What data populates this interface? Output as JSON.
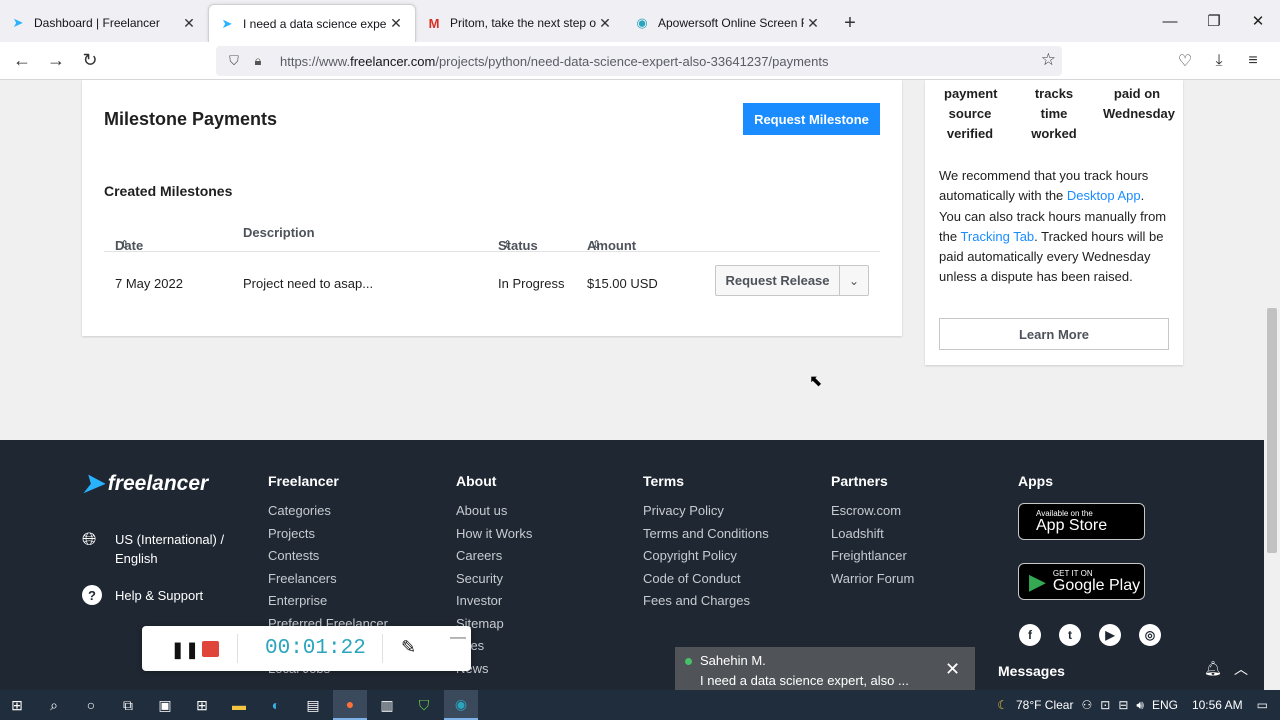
{
  "browser": {
    "tabs": [
      {
        "title": "Dashboard | Freelancer",
        "icon": "freelancer-icon",
        "active": false
      },
      {
        "title": "I need a data science expert, also",
        "icon": "freelancer-icon",
        "active": true
      },
      {
        "title": "Pritom, take the next step on yo",
        "icon": "gmail-icon",
        "active": false
      },
      {
        "title": "Apowersoft Online Screen Reco",
        "icon": "apowersoft-icon",
        "active": false
      }
    ],
    "url_prefix": "https://www.",
    "url_domain": "freelancer.com",
    "url_path": "/projects/python/need-data-science-expert-also-33641237/payments"
  },
  "milestones": {
    "title": "Milestone Payments",
    "request_button": "Request Milestone",
    "created_title": "Created Milestones",
    "columns": {
      "date": "Date",
      "description": "Description",
      "status": "Status",
      "amount": "Amount"
    },
    "rows": [
      {
        "date": "7 May 2022",
        "description": "Project need to asap...",
        "status": "In Progress",
        "amount": "$15.00 USD",
        "action": "Request Release"
      }
    ]
  },
  "sidebar": {
    "col1": [
      "payment",
      "source",
      "verified"
    ],
    "col2": [
      "tracks time",
      "worked"
    ],
    "col3": [
      "paid on",
      "Wednesday"
    ],
    "text_before_app": "We recommend that you track hours automatically with the ",
    "link_app": "Desktop App",
    "text_mid": ". You can also track hours manually from the ",
    "link_tab": "Tracking Tab",
    "text_after": ". Tracked hours will be paid automatically every Wednesday unless a dispute has been raised.",
    "learn_more": "Learn More"
  },
  "footer": {
    "logo": "freelancer",
    "language": "US (International) / English",
    "help": "Help & Support",
    "columns": [
      {
        "title": "Freelancer",
        "links": [
          "Categories",
          "Projects",
          "Contests",
          "Freelancers",
          "Enterprise",
          "Preferred Freelancer",
          "",
          "Local Jobs"
        ]
      },
      {
        "title": "About",
        "links": [
          "About us",
          "How it Works",
          "Careers",
          "Security",
          "Investor",
          "Sitemap",
          "ories",
          "News"
        ]
      },
      {
        "title": "Terms",
        "links": [
          "Privacy Policy",
          "Terms and Conditions",
          "Copyright Policy",
          "Code of Conduct",
          "Fees and Charges"
        ]
      },
      {
        "title": "Partners",
        "links": [
          "Escrow.com",
          "Loadshift",
          "Freightlancer",
          "Warrior Forum"
        ]
      }
    ],
    "apps_title": "Apps",
    "appstore_small": "Available on the",
    "appstore_big": "App Store",
    "googleplay_small": "GET IT ON",
    "googleplay_big": "Google Play"
  },
  "recorder": {
    "time": "00:01:22"
  },
  "notification": {
    "name": "Sahehin M.",
    "message": "I need a data science expert, also ..."
  },
  "messages": {
    "title": "Messages"
  },
  "taskbar": {
    "weather": "78°F  Clear",
    "lang": "ENG",
    "time": "10:56 AM"
  }
}
